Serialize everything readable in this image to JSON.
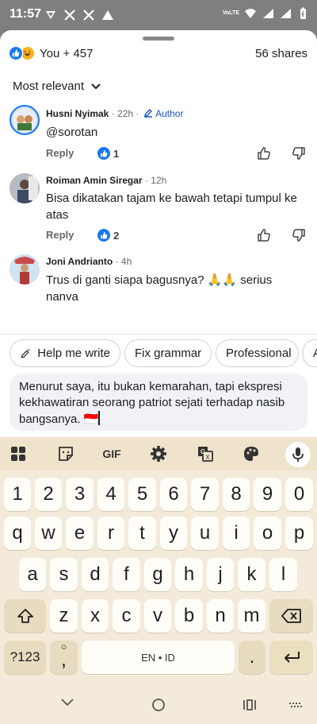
{
  "status_bar": {
    "time": "11:57",
    "network": "VoLTE",
    "left_icons": [
      "vpn-icon",
      "x-logo-icon",
      "x-logo-icon",
      "delta-icon"
    ],
    "right_icons": [
      "wifi-icon",
      "signal-icon",
      "signal-icon",
      "battery-icon"
    ]
  },
  "post": {
    "reactions_text": "You + 457",
    "shares_text": "56 shares",
    "sort_label": "Most relevant"
  },
  "comments": [
    {
      "name": "Husni Nyimak",
      "time": "· 22h ·",
      "author_badge": "Author",
      "text": "@sorotan",
      "reply_label": "Reply",
      "likes": "1",
      "avatar_color": "#c9dcef"
    },
    {
      "name": "Roiman Amin Siregar",
      "time": "· 12h",
      "author_badge": "",
      "text": "Bisa dikatakan tajam ke bawah tetapi tumpul ke atas",
      "reply_label": "Reply",
      "likes": "2",
      "avatar_color": "#8a8f98"
    },
    {
      "name": "Joni Andrianto",
      "time": "· 4h",
      "author_badge": "",
      "text": "Trus di ganti siapa bagusnya? 🙏🙏 serius nanya",
      "reply_label": "",
      "likes": "",
      "avatar_color": "#d9a2a2"
    }
  ],
  "chips": [
    "Help me write",
    "Fix grammar",
    "Professional",
    "A"
  ],
  "composer": {
    "text": "Menurut saya, itu bukan kemarahan, tapi ekspresi kekhawatiran seorang patriot sejati terhadap nasib bangsanya. 🇮🇩",
    "tools": [
      "camera-icon",
      "gif-icon",
      "emoji-icon",
      "avatar-sticker-icon",
      "sparkle-icon",
      "send-icon"
    ]
  },
  "keyboard": {
    "toolbar": [
      "apps-grid-icon",
      "sticker-icon",
      "gif-icon",
      "settings-icon",
      "translate-icon",
      "palette-icon",
      "mic-icon"
    ],
    "gif_label": "GIF",
    "row_numbers": [
      "1",
      "2",
      "3",
      "4",
      "5",
      "6",
      "7",
      "8",
      "9",
      "0"
    ],
    "row1": [
      "q",
      "w",
      "e",
      "r",
      "t",
      "y",
      "u",
      "i",
      "o",
      "p"
    ],
    "row2": [
      "a",
      "s",
      "d",
      "f",
      "g",
      "h",
      "j",
      "k",
      "l"
    ],
    "row3": [
      "z",
      "x",
      "c",
      "v",
      "b",
      "n",
      "m"
    ],
    "symbols_label": "?123",
    "comma_label": ",",
    "space_label": "EN • ID",
    "period_label": "."
  },
  "colors": {
    "accent": "#1877f2",
    "keyboard_bg": "#f3ead9"
  }
}
